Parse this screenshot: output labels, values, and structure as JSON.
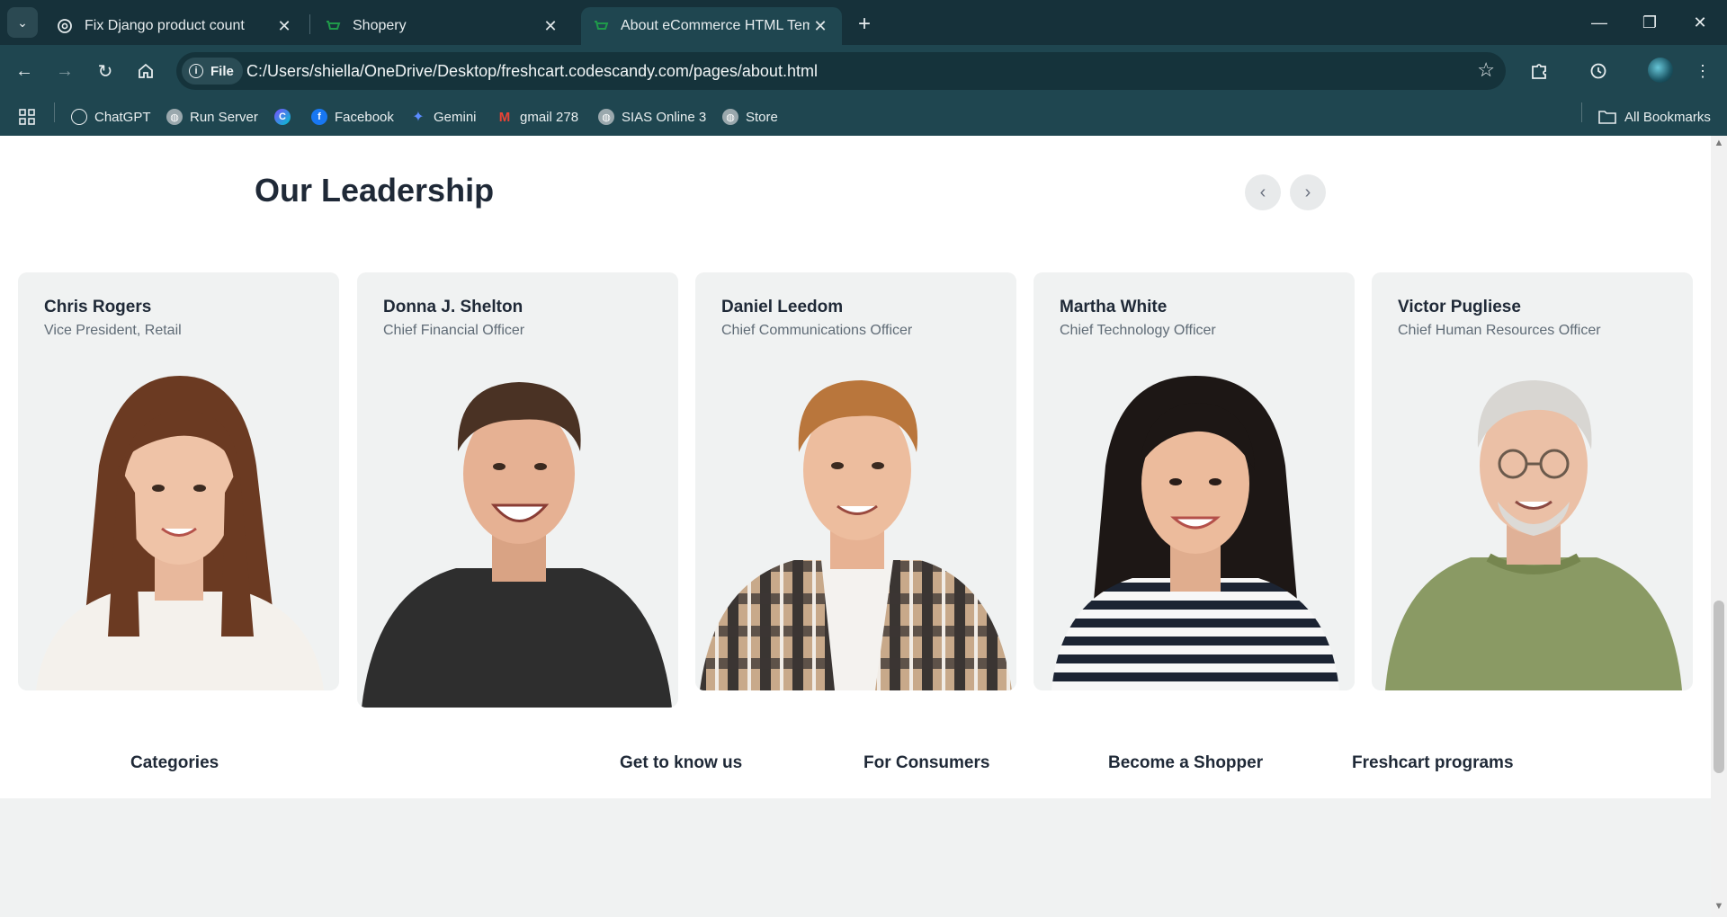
{
  "browser": {
    "tabs": [
      {
        "title": "Fix Django product count",
        "icon": "chatgpt-icon"
      },
      {
        "title": "Shopery",
        "icon": "cart-icon"
      },
      {
        "title": "About eCommerce HTML Temp",
        "icon": "cart-icon",
        "active": true
      }
    ],
    "omnibox": {
      "scheme_label": "File",
      "url": "C:/Users/shiella/OneDrive/Desktop/freshcart.codescandy.com/pages/about.html"
    },
    "bookmarks": [
      {
        "label": "ChatGPT",
        "icon": "chatgpt-icon"
      },
      {
        "label": "Run Server",
        "icon": "globe-icon"
      },
      {
        "label": "",
        "icon": "canva-icon"
      },
      {
        "label": "Facebook",
        "icon": "facebook-icon"
      },
      {
        "label": "Gemini",
        "icon": "gemini-icon"
      },
      {
        "label": "gmail 278",
        "icon": "gmail-icon"
      },
      {
        "label": "SIAS Online 3",
        "icon": "globe-icon"
      },
      {
        "label": "Store",
        "icon": "globe-icon"
      }
    ],
    "all_bookmarks_label": "All Bookmarks"
  },
  "leadership": {
    "title": "Our Leadership",
    "members": [
      {
        "name": "Chris Rogers",
        "role": "Vice President, Retail"
      },
      {
        "name": "Donna J. Shelton",
        "role": "Chief Financial Officer"
      },
      {
        "name": "Daniel Leedom",
        "role": "Chief Communications Officer"
      },
      {
        "name": "Martha White",
        "role": "Chief Technology Officer"
      },
      {
        "name": "Victor Pugliese",
        "role": "Chief Human Resources Officer"
      }
    ]
  },
  "footer": {
    "headings": [
      "Categories",
      "Get to know us",
      "For Consumers",
      "Become a Shopper",
      "Freshcart programs"
    ]
  },
  "colors": {
    "chrome_dark": "#16313a",
    "chrome": "#1f4650",
    "card_bg": "#f0f2f2",
    "heading": "#1f2937"
  }
}
